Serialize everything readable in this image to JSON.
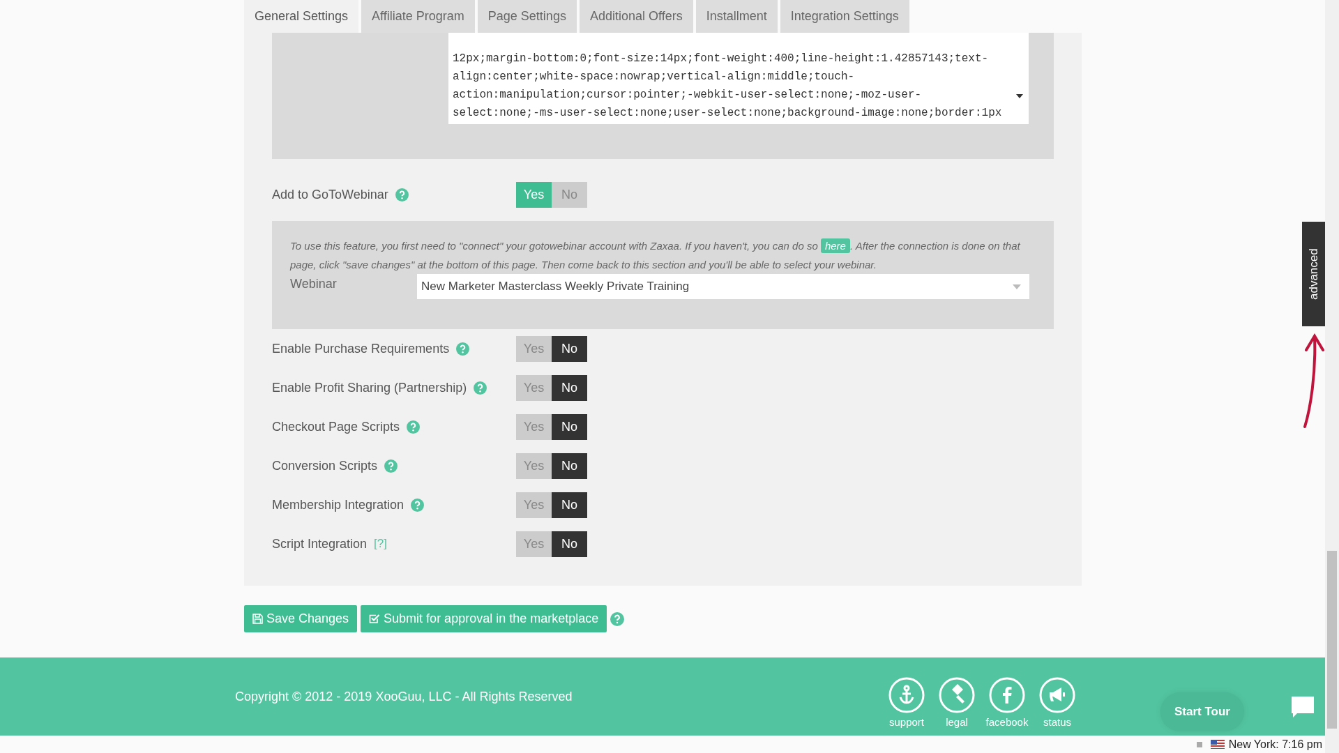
{
  "tabs": [
    {
      "label": "General Settings",
      "selected": true
    },
    {
      "label": "Affiliate Program",
      "selected": false
    },
    {
      "label": "Page Settings",
      "selected": false
    },
    {
      "label": "Additional Offers",
      "selected": false
    },
    {
      "label": "Installment",
      "selected": false
    },
    {
      "label": "Integration Settings",
      "selected": false
    }
  ],
  "code_field": {
    "value": "12px;margin-bottom:0;font-size:14px;font-weight:400;line-height:1.42857143;text-\nalign:center;white-space:nowrap;vertical-align:middle;touch-\naction:manipulation;cursor:pointer;-webkit-user-select:none;-moz-user-\nselect:none;-ms-user-select:none;user-select:none;background-image:none;border:1px"
  },
  "rows": [
    {
      "kind": "toggle",
      "label": "Add to GoToWebinar",
      "help_icon": true,
      "options": [
        {
          "label": "Yes",
          "selected": true
        },
        {
          "label": "No",
          "selected": false
        }
      ]
    },
    {
      "kind": "panel",
      "note_before": "To use this feature, you first need to \"connect\" your gotowebinar account with Zaxaa. If you haven't, you can do so",
      "link": "here",
      "note_after": ". After the connection is done on that page, click \"save changes\" at the bottom of this page. Then come back to this section and you'll be able to select your webinar.",
      "field_label": "Webinar",
      "value": "New Marketer Masterclass Weekly Private Training"
    },
    {
      "kind": "toggle",
      "label": "Enable Purchase Requirements",
      "help_icon": true,
      "options": [
        {
          "label": "Yes",
          "selected": false
        },
        {
          "label": "No",
          "selected": true
        }
      ]
    },
    {
      "kind": "toggle",
      "label": "Enable Profit Sharing (Partnership)",
      "help_icon": true,
      "options": [
        {
          "label": "Yes",
          "selected": false
        },
        {
          "label": "No",
          "selected": true
        }
      ]
    },
    {
      "kind": "toggle",
      "label": "Checkout Page Scripts",
      "help_icon": true,
      "options": [
        {
          "label": "Yes",
          "selected": false
        },
        {
          "label": "No",
          "selected": true
        }
      ]
    },
    {
      "kind": "toggle",
      "label": "Conversion Scripts",
      "help_icon": true,
      "options": [
        {
          "label": "Yes",
          "selected": false
        },
        {
          "label": "No",
          "selected": true
        }
      ]
    },
    {
      "kind": "toggle",
      "label": "Membership Integration",
      "help_icon": true,
      "options": [
        {
          "label": "Yes",
          "selected": false
        },
        {
          "label": "No",
          "selected": true
        }
      ]
    },
    {
      "kind": "toggle",
      "label": "Script Integration",
      "help_link": "[?]",
      "options": [
        {
          "label": "Yes",
          "selected": false
        },
        {
          "label": "No",
          "selected": true
        }
      ]
    }
  ],
  "actions": [
    {
      "label": "Save Changes",
      "kind": "save"
    },
    {
      "label": "Submit for approval in the marketplace",
      "kind": "submit"
    }
  ],
  "footer": {
    "copyright": "Copyright © 2012 - 2019 XooGuu, LLC - All Rights Reserved",
    "links": [
      {
        "label": "support",
        "kind": "anchor"
      },
      {
        "label": "legal",
        "kind": "gavel"
      },
      {
        "label": "facebook",
        "kind": "facebook"
      },
      {
        "label": "status",
        "kind": "megaphone"
      }
    ],
    "tour": "Start Tour"
  },
  "side_tab": "advanced",
  "status_bar": {
    "clock": "New York: 7:16 pm"
  }
}
